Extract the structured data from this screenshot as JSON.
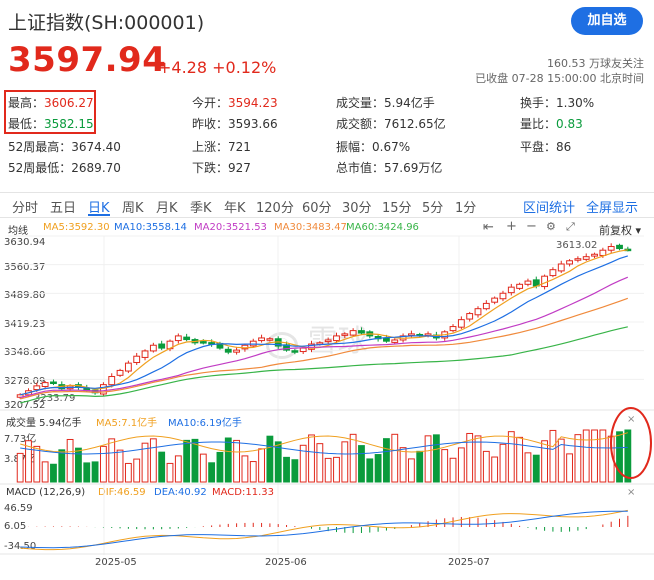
{
  "header": {
    "title": "上证指数(SH:000001)",
    "add_button": "加自选",
    "price": "3597.94",
    "change": "+4.28 +0.12%",
    "followers": "160.53 万球友关注",
    "status": "已收盘 07-28 15:00:00 北京时间"
  },
  "quote": {
    "high_label": "最高：",
    "high": "3606.27",
    "low_label": "最低：",
    "low": "3582.15",
    "w52_high_label": "52周最高：",
    "w52_high": "3674.40",
    "w52_low_label": "52周最低：",
    "w52_low": "2689.70",
    "open_label": "今开：",
    "open": "3594.23",
    "prev_close_label": "昨收：",
    "prev_close": "3593.66",
    "up_label": "上涨：",
    "up": "721",
    "down_label": "下跌：",
    "down": "927",
    "volume_label": "成交量：",
    "volume": "5.94亿手",
    "amount_label": "成交额：",
    "amount": "7612.65亿",
    "amplitude_label": "振幅：",
    "amplitude": "0.67%",
    "mktcap_label": "总市值：",
    "mktcap": "57.69万亿",
    "turnover_label": "换手：",
    "turnover": "1.30%",
    "vol_ratio_label": "量比：",
    "vol_ratio": "0.83",
    "flat_label": "平盘：",
    "flat": "86"
  },
  "tabs": [
    "分时",
    "五日",
    "日K",
    "周K",
    "月K",
    "季K",
    "年K",
    "120分",
    "60分",
    "30分",
    "15分",
    "5分",
    "1分"
  ],
  "active_tab": "日K",
  "tab_links": {
    "stats": "区间统计",
    "fullscreen": "全屏显示"
  },
  "kline": {
    "ma_label": "均线",
    "ma5": "MA5:3592.30",
    "ma10": "MA10:3558.14",
    "ma20": "MA20:3521.53",
    "ma30": "MA30:3483.47",
    "ma60": "MA60:3424.96",
    "fq_label": "前复权",
    "max_label": "3613.02",
    "min_label": "3233.79",
    "y_ticks": [
      "3630.94",
      "3560.37",
      "3489.80",
      "3419.23",
      "3348.66",
      "3278.09",
      "3207.52"
    ],
    "watermark": "雪球"
  },
  "volume_panel": {
    "label": "成交量 5.94亿手",
    "ma5": "MA5:7.1亿手",
    "ma10": "MA10:6.19亿手",
    "y_ticks": [
      "7.73亿",
      "3.87亿"
    ]
  },
  "macd_panel": {
    "label": "MACD (12,26,9)",
    "dif": "DIF:46.59",
    "dea": "DEA:40.92",
    "macd": "MACD:11.33",
    "y_ticks": [
      "46.59",
      "6.05",
      "-34.50"
    ]
  },
  "x_axis": [
    "2025-05",
    "2025-06",
    "2025-07"
  ],
  "chart_data": {
    "type": "candlestick",
    "y_range": [
      3207.52,
      3630.94
    ],
    "series_close": [
      3240,
      3250,
      3262,
      3270,
      3268,
      3255,
      3262,
      3258,
      3250,
      3245,
      3265,
      3285,
      3300,
      3318,
      3335,
      3348,
      3362,
      3355,
      3372,
      3385,
      3376,
      3368,
      3370,
      3365,
      3355,
      3345,
      3350,
      3362,
      3372,
      3380,
      3378,
      3360,
      3350,
      3345,
      3355,
      3365,
      3368,
      3375,
      3385,
      3390,
      3398,
      3392,
      3385,
      3378,
      3372,
      3375,
      3385,
      3390,
      3385,
      3390,
      3380,
      3395,
      3408,
      3425,
      3440,
      3452,
      3465,
      3478,
      3490,
      3505,
      3512,
      3520,
      3508,
      3532,
      3548,
      3562,
      3570,
      3575,
      3580,
      3586,
      3596,
      3605,
      3600,
      3598
    ],
    "colors": {
      "up": "#e1291c",
      "down": "#0a9b3c",
      "ma5": "#f0a020",
      "ma10": "#1e6fe3",
      "ma20": "#c13cc4",
      "ma30": "#f08a3c",
      "ma60": "#38b448"
    }
  }
}
